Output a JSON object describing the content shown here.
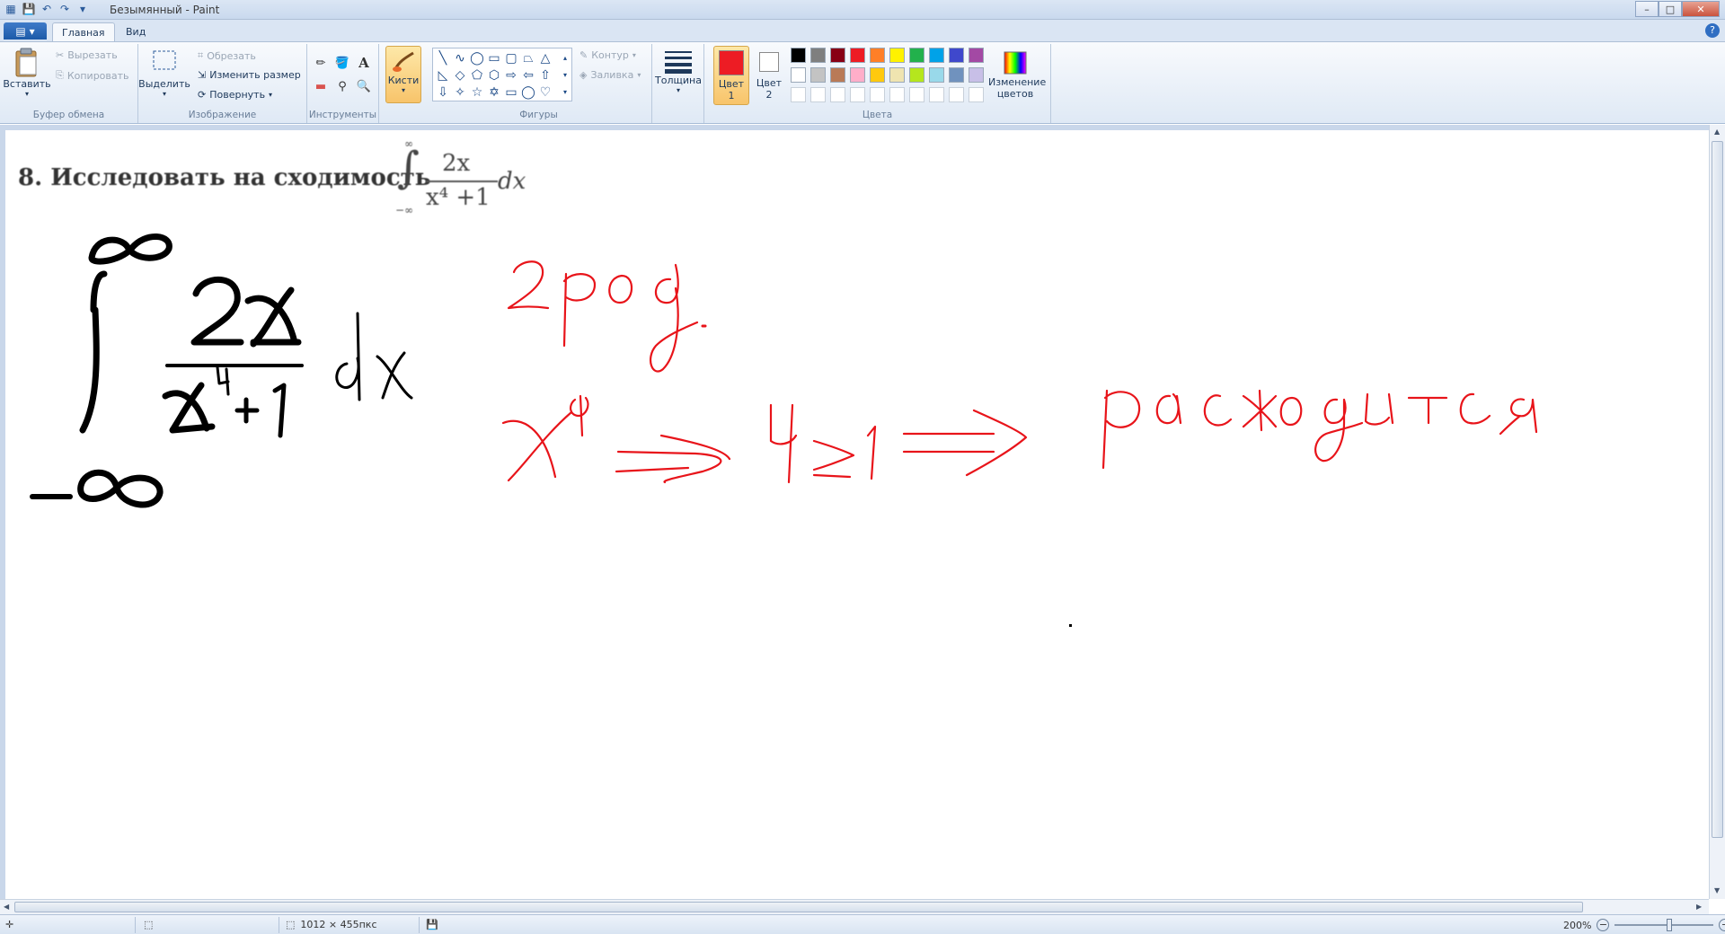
{
  "window": {
    "title": "Безымянный - Paint"
  },
  "tabs": {
    "home": "Главная",
    "view": "Вид"
  },
  "ribbon": {
    "clipboard": {
      "label": "Буфер обмена",
      "paste": "Вставить",
      "cut": "Вырезать",
      "copy": "Копировать"
    },
    "image": {
      "label": "Изображение",
      "select": "Выделить",
      "crop": "Обрезать",
      "resize": "Изменить размер",
      "rotate": "Повернуть"
    },
    "tools": {
      "label": "Инструменты",
      "brushes": "Кисти"
    },
    "shapes": {
      "label": "Фигуры",
      "outline": "Контур",
      "fill": "Заливка"
    },
    "size": {
      "label": "Толщина"
    },
    "colors": {
      "label": "Цвета",
      "color1": "Цвет",
      "color1_num": "1",
      "color2": "Цвет",
      "color2_num": "2",
      "edit": "Изменение цветов",
      "color1_value": "#ed1c24",
      "color2_value": "#ffffff",
      "palette_row1": [
        "#000000",
        "#7f7f7f",
        "#880015",
        "#ed1c24",
        "#ff7f27",
        "#fff200",
        "#22b14c",
        "#00a2e8",
        "#3f48cc",
        "#a349a4"
      ],
      "palette_row2": [
        "#ffffff",
        "#c3c3c3",
        "#b97a57",
        "#ffaec9",
        "#ffc90e",
        "#efe4b0",
        "#b5e61d",
        "#99d9ea",
        "#7092be",
        "#c8bfe7"
      ]
    }
  },
  "canvas": {
    "printed_text": "8.   Исследовать на сходимость",
    "printed_numerator": "2x",
    "printed_denominator": "x⁴ +1",
    "printed_dx": "dx",
    "printed_upper": "∞",
    "printed_lower": "−∞"
  },
  "statusbar": {
    "dimensions": "1012 × 455пкс",
    "zoom": "200%"
  }
}
